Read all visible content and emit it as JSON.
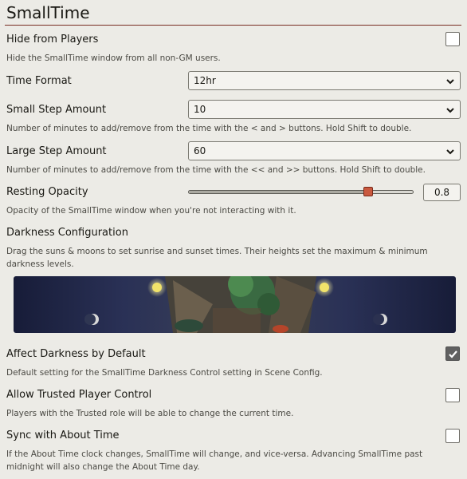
{
  "module_title": "SmallTime",
  "settings": {
    "hide_from_players": {
      "label": "Hide from Players",
      "hint": "Hide the SmallTime window from all non-GM users.",
      "checked": false
    },
    "time_format": {
      "label": "Time Format",
      "value": "12hr"
    },
    "small_step": {
      "label": "Small Step Amount",
      "value": "10",
      "hint": "Number of minutes to add/remove from the time with the < and > buttons. Hold Shift to double."
    },
    "large_step": {
      "label": "Large Step Amount",
      "value": "60",
      "hint": "Number of minutes to add/remove from the time with the << and >> buttons. Hold Shift to double."
    },
    "resting_opacity": {
      "label": "Resting Opacity",
      "value": "0.8",
      "hint": "Opacity of the SmallTime window when you're not interacting with it."
    },
    "darkness_config": {
      "label": "Darkness Configuration",
      "hint": "Drag the suns & moons to set sunrise and sunset times. Their heights set the maximum & minimum darkness levels."
    },
    "affect_darkness": {
      "label": "Affect Darkness by Default",
      "hint": "Default setting for the SmallTime Darkness Control setting in Scene Config.",
      "checked": true
    },
    "trusted_control": {
      "label": "Allow Trusted Player Control",
      "hint": "Players with the Trusted role will be able to change the current time.",
      "checked": false
    },
    "sync_about_time": {
      "label": "Sync with About Time",
      "hint": "If the About Time clock changes, SmallTime will change, and vice-versa. Advancing SmallTime past midnight will also change the About Time day.",
      "checked": false
    }
  },
  "colors": {
    "title_rule": "#782e22",
    "slider_thumb": "#c9593f",
    "checkbox_checked": "#606060"
  },
  "icons": {
    "select_chevron": "chevron-down-icon",
    "checkmark": "check-icon",
    "sun": "sun-icon",
    "moon": "moon-icon"
  }
}
